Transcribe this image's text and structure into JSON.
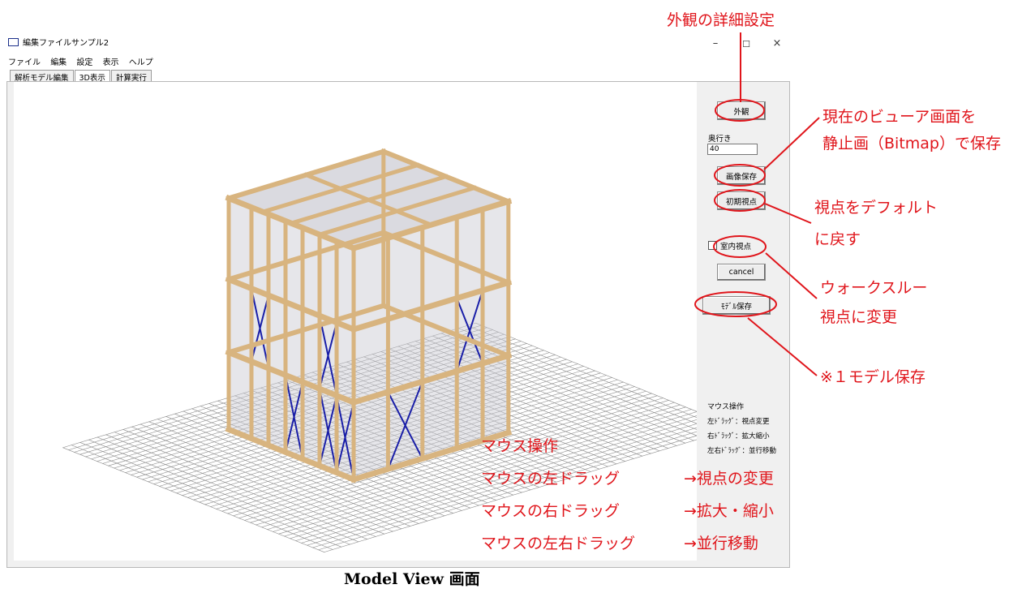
{
  "window": {
    "title": "編集ファイルサンプル2",
    "minimize_glyph": "–",
    "maximize_glyph": "☐",
    "close_glyph": "×"
  },
  "menu": [
    "ファイル",
    "編集",
    "設定",
    "表示",
    "ヘルプ"
  ],
  "tabs": [
    {
      "label": "解析モデル編集",
      "active": false
    },
    {
      "label": "3D表示",
      "active": true
    },
    {
      "label": "計算実行",
      "active": false
    }
  ],
  "panel": {
    "appearance_button": "外観",
    "depth_label": "奥行き",
    "depth_value": "40",
    "save_image_button": "画像保存",
    "initial_view_button": "初期視点",
    "indoor_view_checkbox": "室内視点",
    "indoor_view_checked": false,
    "cancel_button": "cancel",
    "model_save_button": "ﾓﾃﾞﾙ保存",
    "mouse_help_title": "マウス操作",
    "mouse_help_lines": [
      "左ﾄﾞﾗｯｸﾞ：視点変更",
      "右ﾄﾞﾗｯｸﾞ：拡大縮小",
      "左右ﾄﾞﾗｯｸﾞ：並行移動"
    ]
  },
  "annotations": {
    "appearance_detail": "外観の詳細設定",
    "save_image": [
      "現在のビューア画面を",
      "静止画（Bitmap）で保存"
    ],
    "default_view": [
      "視点をデフォルト",
      "に戻す"
    ],
    "walkthrough": [
      "ウォークスルー",
      "視点に変更"
    ],
    "model_save_note": "※１モデル保存",
    "mouse": {
      "title": "マウス操作",
      "rows": [
        {
          "action": "マウスの左ドラッグ",
          "result": "→視点の変更"
        },
        {
          "action": "マウスの右ドラッグ",
          "result": "→拡大・縮小"
        },
        {
          "action": "マウスの左右ドラッグ",
          "result": "→並行移動"
        }
      ]
    }
  },
  "caption": "Model View 画面",
  "colors": {
    "annotation_red": "#e0151b",
    "timber": "#d8b47f",
    "brace": "#1a1fa8",
    "panel_bg": "#f0f0f0"
  }
}
